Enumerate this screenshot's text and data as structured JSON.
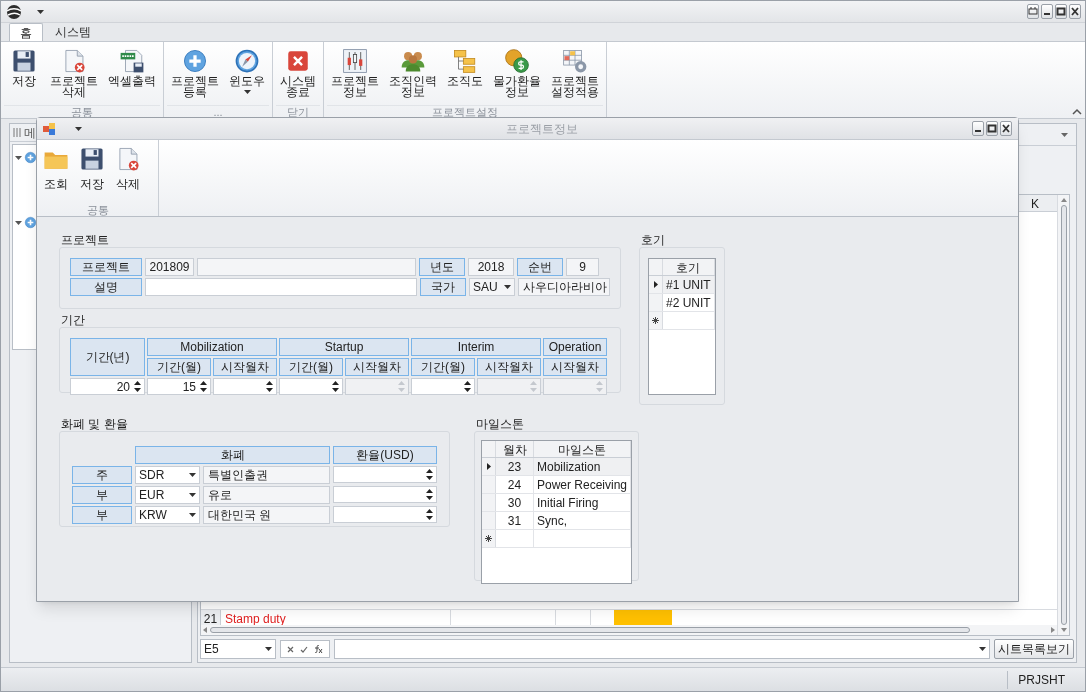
{
  "main_window": {
    "tabs": [
      {
        "label": "홈",
        "selected": true
      },
      {
        "label": "시스템",
        "selected": false
      }
    ],
    "ribbon_groups": [
      {
        "label": "공통",
        "buttons": [
          {
            "label": "저장"
          },
          {
            "label": "프로젝트\n삭제"
          },
          {
            "label": "엑셀출력"
          }
        ]
      },
      {
        "label": "...",
        "buttons": [
          {
            "label": "프로젝트\n등록"
          },
          {
            "label": "윈도우"
          }
        ]
      },
      {
        "label": "닫기",
        "buttons": [
          {
            "label": "시스템\n종료"
          }
        ]
      },
      {
        "label": "프로젝트설정",
        "buttons": [
          {
            "label": "프로젝트\n정보"
          },
          {
            "label": "조직인력\n정보"
          },
          {
            "label": "조직도"
          },
          {
            "label": "물가환율\n정보"
          },
          {
            "label": "프로젝트\n설정적용"
          }
        ]
      }
    ],
    "side_panel": {
      "title": "메"
    },
    "sheet": {
      "column_header": "K",
      "row": {
        "number": "21",
        "text": "Stamp duty"
      },
      "name_box": "E5",
      "sheet_list_button": "시트목록보기"
    },
    "status_bar": "PRJSHT"
  },
  "dialog": {
    "title": "프로젝트정보",
    "ribbon_group": {
      "label": "공통",
      "buttons": [
        {
          "label": "조회"
        },
        {
          "label": "저장"
        },
        {
          "label": "삭제"
        }
      ]
    },
    "project": {
      "title": "프로젝트",
      "project_label": "프로젝트",
      "code": "201809",
      "year_label": "년도",
      "year": "2018",
      "seq_label": "순번",
      "seq": "9",
      "desc_label": "설명",
      "country_label": "국가",
      "country_code": "SAU",
      "country_name": "사우디아라비아"
    },
    "period": {
      "title": "기간",
      "years_label": "기간(년)",
      "phases": [
        {
          "name": "Mobilization",
          "columns": [
            "기간(월)",
            "시작월차"
          ]
        },
        {
          "name": "Startup",
          "columns": [
            "기간(월)",
            "시작월차"
          ]
        },
        {
          "name": "Interim",
          "columns": [
            "기간(월)",
            "시작월차"
          ]
        },
        {
          "name": "Operation",
          "columns": [
            "시작월차"
          ]
        }
      ],
      "spinners": [
        {
          "value": "20",
          "disabled": false
        },
        {
          "value": "15",
          "disabled": false
        },
        {
          "disabled": false
        },
        {
          "disabled": false
        },
        {
          "disabled": true
        },
        {
          "disabled": false
        },
        {
          "disabled": true
        },
        {
          "disabled": true
        }
      ]
    },
    "units": {
      "title": "호기",
      "column": "호기",
      "rows": [
        {
          "name": "#1 UNIT",
          "selected": true
        },
        {
          "name": "#2 UNIT",
          "selected": false
        }
      ]
    },
    "currency": {
      "title": "화폐 및 환율",
      "columns": [
        "화폐",
        "환율(USD)"
      ],
      "rows": [
        {
          "label": "주",
          "code": "SDR",
          "name": "특별인출권"
        },
        {
          "label": "부",
          "code": "EUR",
          "name": "유로"
        },
        {
          "label": "부",
          "code": "KRW",
          "name": "대한민국 원"
        }
      ]
    },
    "milestones": {
      "title": "마일스톤",
      "columns": [
        "월차",
        "마일스톤"
      ],
      "rows": [
        {
          "month": "23",
          "name": "Mobilization",
          "selected": true
        },
        {
          "month": "24",
          "name": "Power Receiving",
          "selected": false
        },
        {
          "month": "30",
          "name": "Initial Firing",
          "selected": false
        },
        {
          "month": "31",
          "name": "Sync,",
          "selected": false
        }
      ]
    }
  }
}
